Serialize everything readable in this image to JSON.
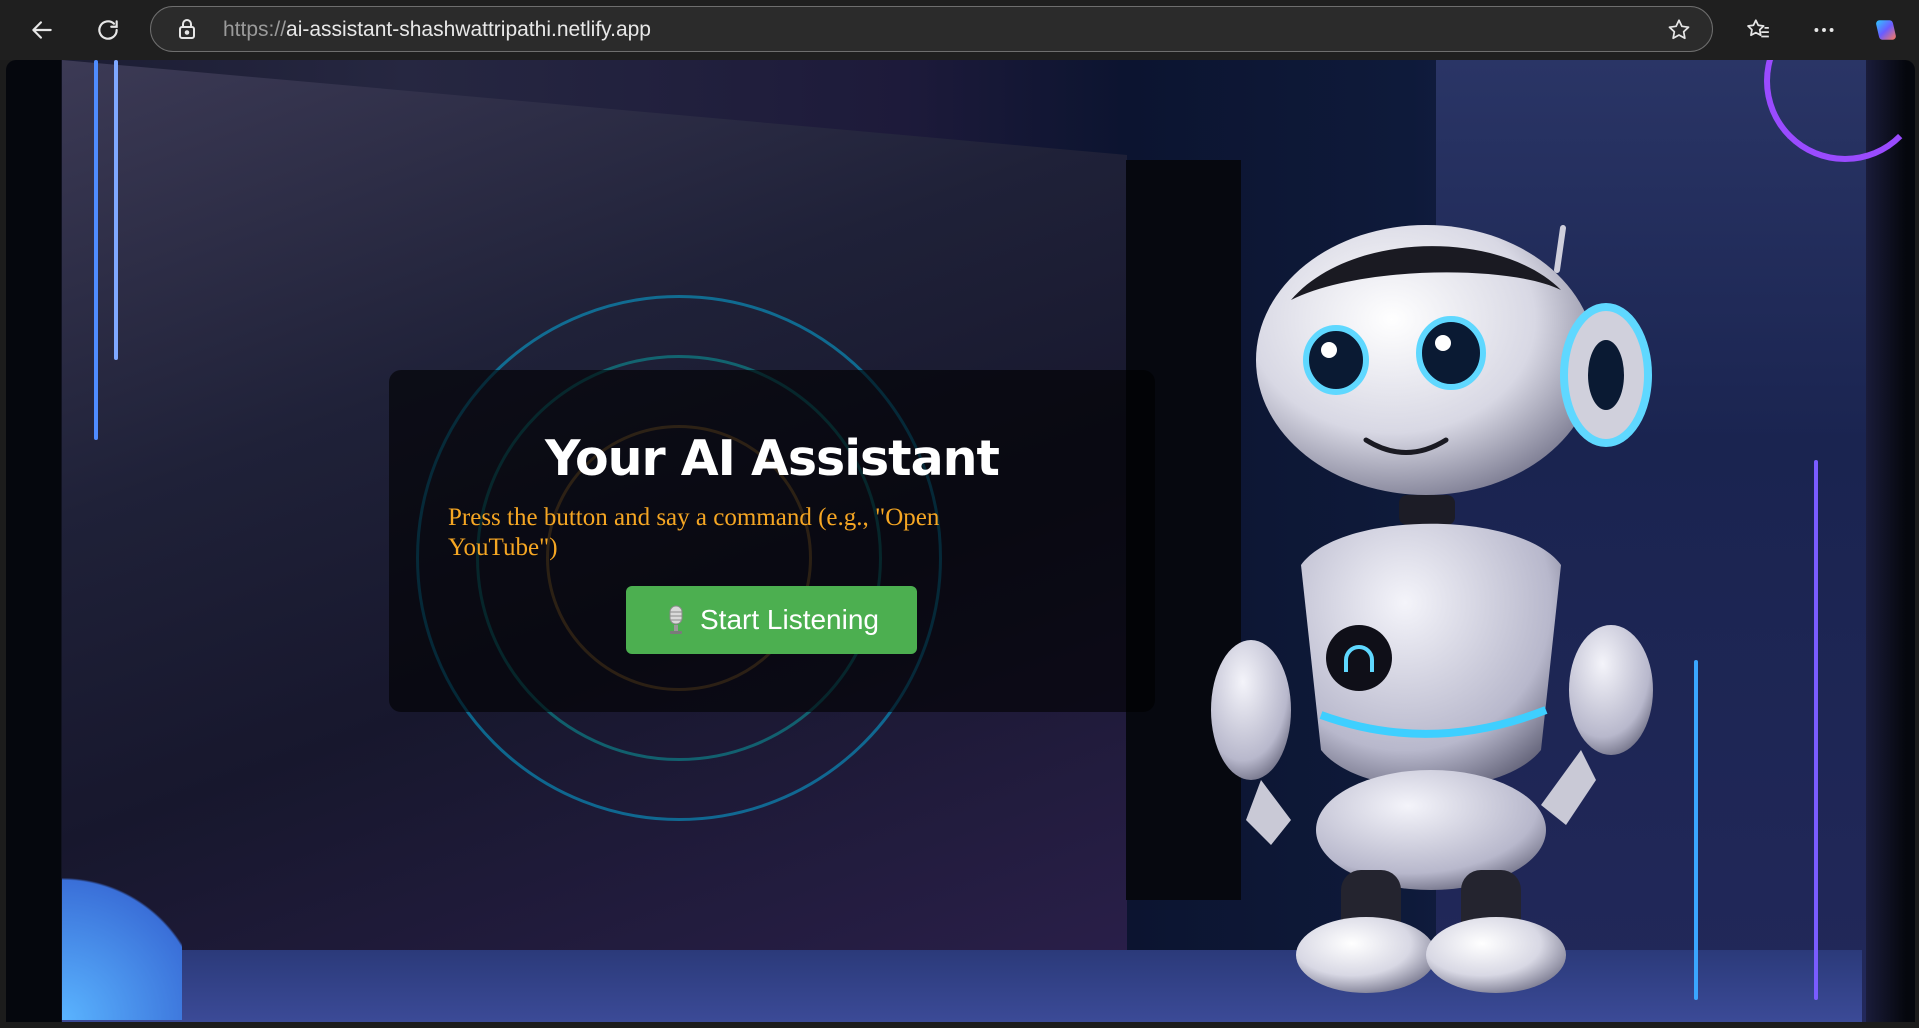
{
  "browser": {
    "url_protocol": "https://",
    "url_host": "ai-assistant-shashwattripathi.netlify.app",
    "icons": [
      "back-icon",
      "refresh-icon",
      "lock-icon",
      "star-icon",
      "favorites-icon",
      "more-icon",
      "copilot-icon"
    ]
  },
  "page": {
    "title": "Your AI Assistant",
    "subtitle": "Press the button and say a command (e.g., \"Open YouTube\")",
    "button_label": "Start Listening"
  },
  "colors": {
    "button": "#4caf50",
    "subtitle": "#f5a623",
    "title": "#ffffff",
    "card_overlay": "rgba(0,0,0,0.6)"
  }
}
